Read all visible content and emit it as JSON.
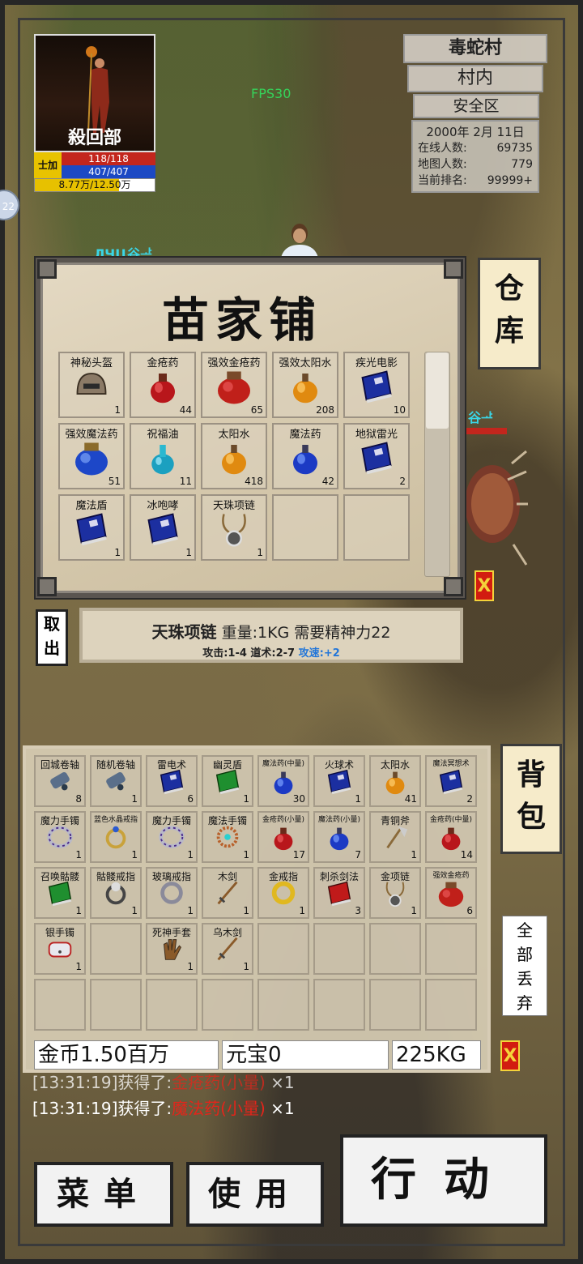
{
  "player": {
    "name": "殺回部",
    "level_label": "士加",
    "hp": "118/118",
    "mp": "407/407",
    "exp": "8.77万/12.50万",
    "exp_fraction": 0.7
  },
  "fps": "FPS30",
  "map": {
    "name": "毒蛇村",
    "zone": "村内",
    "safety": "安全区",
    "date": "2000年 2月 11日",
    "online_label": "在线人数:",
    "online_value": "69735",
    "map_players_label": "地图人数:",
    "map_players_value": "779",
    "rank_label": "当前排名:",
    "rank_value": "99999+"
  },
  "side_badge": "22",
  "floating_names": [
    "ЛЧЦ谷ᅶ",
    "谷ᅶ"
  ],
  "shop": {
    "title": "苗家铺",
    "items": [
      {
        "name": "神秘头盔",
        "count": "1",
        "icon": "helmet-icon"
      },
      {
        "name": "金疮药",
        "count": "44",
        "icon": "red-potion-icon"
      },
      {
        "name": "强效金疮药",
        "count": "65",
        "icon": "big-red-potion-icon"
      },
      {
        "name": "强效太阳水",
        "count": "208",
        "icon": "orange-potion-icon"
      },
      {
        "name": "疾光电影",
        "count": "10",
        "icon": "blue-book-icon"
      },
      {
        "name": "强效魔法药",
        "count": "51",
        "icon": "big-blue-potion-icon"
      },
      {
        "name": "祝福油",
        "count": "11",
        "icon": "cyan-bottle-icon"
      },
      {
        "name": "太阳水",
        "count": "418",
        "icon": "orange-potion-icon"
      },
      {
        "name": "魔法药",
        "count": "42",
        "icon": "blue-potion-icon"
      },
      {
        "name": "地狱雷光",
        "count": "2",
        "icon": "blue-book-icon"
      },
      {
        "name": "魔法盾",
        "count": "1",
        "icon": "blue-book-icon"
      },
      {
        "name": "冰咆哮",
        "count": "1",
        "icon": "blue-book-icon"
      },
      {
        "name": "天珠项链",
        "count": "1",
        "icon": "necklace-icon"
      },
      {
        "name": "",
        "count": "",
        "icon": ""
      },
      {
        "name": "",
        "count": "",
        "icon": ""
      }
    ]
  },
  "tabs": {
    "warehouse_line1": "仓",
    "warehouse_line2": "库",
    "bag_line1": "背",
    "bag_line2": "包",
    "close_label": "X"
  },
  "cancel_label_1": "取",
  "cancel_label_2": "出",
  "selected_item": {
    "name": "天珠项链",
    "props": "重量:1KG 需要精神力22",
    "stats": "攻击:1-4 道术:2-7",
    "bonus": "攻速:+2"
  },
  "bag": {
    "items": [
      {
        "name": "回城卷轴",
        "count": "8",
        "icon": "scroll-icon",
        "tiny": false
      },
      {
        "name": "随机卷轴",
        "count": "1",
        "icon": "scroll-icon",
        "tiny": false
      },
      {
        "name": "雷电术",
        "count": "6",
        "icon": "blue-book-icon",
        "tiny": false
      },
      {
        "name": "幽灵盾",
        "count": "1",
        "icon": "green-book-icon",
        "tiny": false
      },
      {
        "name": "魔法药(中量)",
        "count": "30",
        "icon": "blue-potion-icon",
        "tiny": true
      },
      {
        "name": "火球术",
        "count": "1",
        "icon": "blue-book-icon",
        "tiny": false
      },
      {
        "name": "太阳水",
        "count": "41",
        "icon": "orange-potion-icon",
        "tiny": false
      },
      {
        "name": "魔法冥想术",
        "count": "2",
        "icon": "blue-book-icon",
        "tiny": true
      },
      {
        "name": "魔力手镯",
        "count": "1",
        "icon": "bracelet-icon",
        "tiny": false
      },
      {
        "name": "蓝色水晶戒指",
        "count": "1",
        "icon": "ring-icon",
        "tiny": true
      },
      {
        "name": "魔力手镯",
        "count": "1",
        "icon": "bracelet-icon",
        "tiny": false
      },
      {
        "name": "魔法手镯",
        "count": "1",
        "icon": "beads-icon",
        "tiny": false
      },
      {
        "name": "金疮药(小量)",
        "count": "17",
        "icon": "red-potion-icon",
        "tiny": true
      },
      {
        "name": "魔法药(小量)",
        "count": "7",
        "icon": "blue-potion-icon",
        "tiny": true
      },
      {
        "name": "青铜斧",
        "count": "1",
        "icon": "axe-icon",
        "tiny": false
      },
      {
        "name": "金疮药(中量)",
        "count": "14",
        "icon": "red-potion-icon",
        "tiny": true
      },
      {
        "name": "召唤骷髅",
        "count": "1",
        "icon": "green-book-icon",
        "tiny": false
      },
      {
        "name": "骷髅戒指",
        "count": "1",
        "icon": "skull-ring-icon",
        "tiny": false
      },
      {
        "name": "玻璃戒指",
        "count": "1",
        "icon": "glass-ring-icon",
        "tiny": false
      },
      {
        "name": "木剑",
        "count": "1",
        "icon": "sword-icon",
        "tiny": false
      },
      {
        "name": "金戒指",
        "count": "1",
        "icon": "gold-ring-icon",
        "tiny": false
      },
      {
        "name": "刺杀剑法",
        "count": "3",
        "icon": "red-book-icon",
        "tiny": false
      },
      {
        "name": "金项链",
        "count": "1",
        "icon": "necklace-icon",
        "tiny": false
      },
      {
        "name": "强效金疮药",
        "count": "6",
        "icon": "big-red-potion-icon",
        "tiny": true
      },
      {
        "name": "银手镯",
        "count": "1",
        "icon": "silver-bracelet-icon",
        "tiny": false
      },
      {
        "name": "",
        "count": "",
        "icon": "",
        "tiny": false
      },
      {
        "name": "死神手套",
        "count": "1",
        "icon": "glove-icon",
        "tiny": false
      },
      {
        "name": "乌木剑",
        "count": "1",
        "icon": "sword-icon",
        "tiny": false
      },
      {
        "name": "",
        "count": "",
        "icon": "",
        "tiny": false
      },
      {
        "name": "",
        "count": "",
        "icon": "",
        "tiny": false
      },
      {
        "name": "",
        "count": "",
        "icon": "",
        "tiny": false
      },
      {
        "name": "",
        "count": "",
        "icon": "",
        "tiny": false
      },
      {
        "name": "",
        "count": "",
        "icon": "",
        "tiny": false
      },
      {
        "name": "",
        "count": "",
        "icon": "",
        "tiny": false
      },
      {
        "name": "",
        "count": "",
        "icon": "",
        "tiny": false
      },
      {
        "name": "",
        "count": "",
        "icon": "",
        "tiny": false
      },
      {
        "name": "",
        "count": "",
        "icon": "",
        "tiny": false
      },
      {
        "name": "",
        "count": "",
        "icon": "",
        "tiny": false
      },
      {
        "name": "",
        "count": "",
        "icon": "",
        "tiny": false
      },
      {
        "name": "",
        "count": "",
        "icon": "",
        "tiny": false
      }
    ],
    "gold_label": "金币",
    "gold_value": "1.50百万",
    "yuanbao_label": "元宝",
    "yuanbao_value": "0",
    "weight": "225KG",
    "drop_all_1": "全",
    "drop_all_2": "部",
    "drop_all_3": "丢",
    "drop_all_4": "弃"
  },
  "log": [
    {
      "time": "[13:31:19]获得了:",
      "item": "金疮药(小量)",
      "qty": "×1"
    },
    {
      "time": "[13:31:19]获得了:",
      "item": "魔法药(小量)",
      "qty": "×1"
    }
  ],
  "buttons": {
    "menu": "菜单",
    "use": "使用",
    "action": "行动"
  },
  "colors": {
    "hp": "#c3261d",
    "mp": "#1c49c4",
    "exp": "#e7c100",
    "close": "#d21c10",
    "log_item": "#e5241a",
    "fps": "#35d35a"
  }
}
